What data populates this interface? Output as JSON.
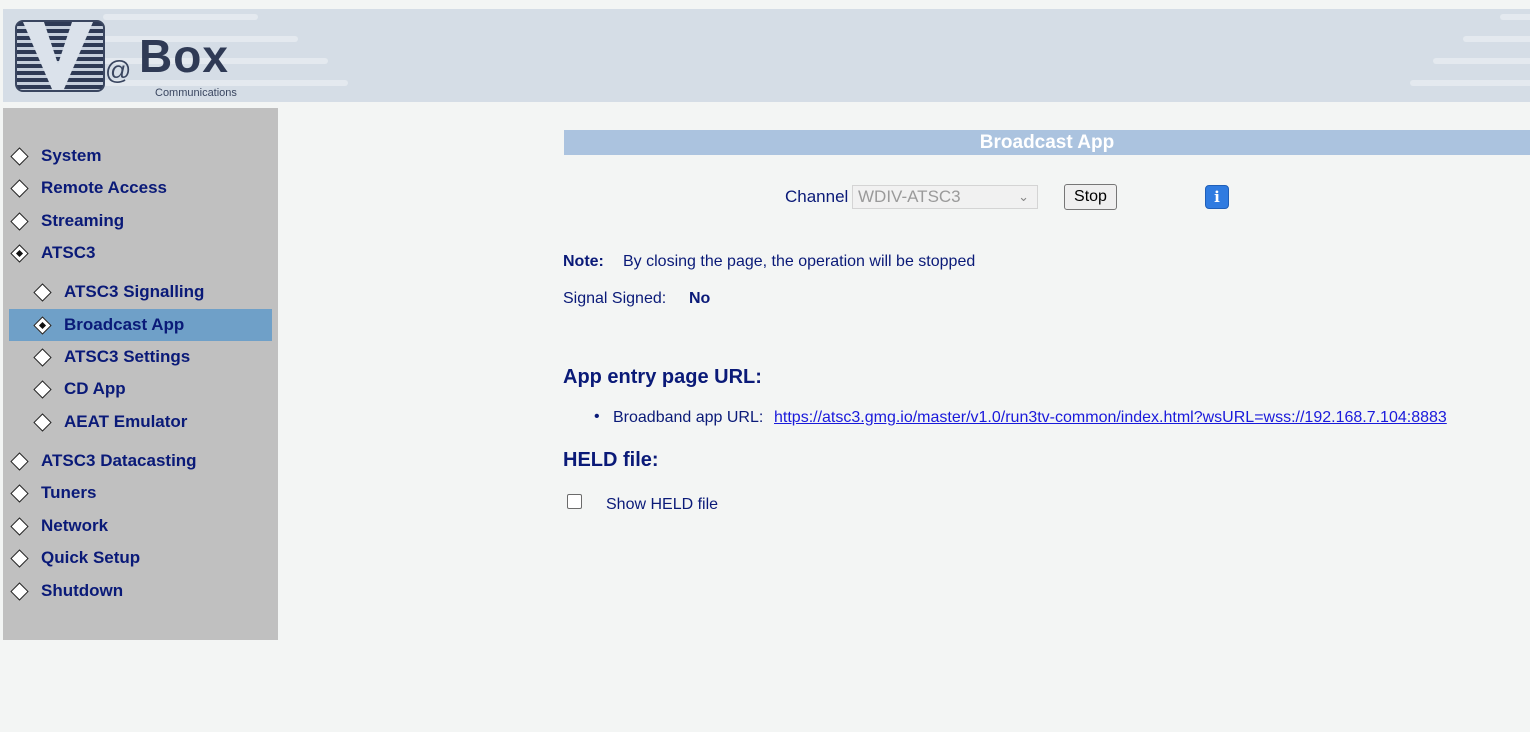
{
  "brand": {
    "logo_at": "@",
    "logo_box": "Box",
    "logo_sub": "Communications"
  },
  "sidebar": {
    "items": [
      {
        "label": "System",
        "active": false,
        "sub": false
      },
      {
        "label": "Remote Access",
        "active": false,
        "sub": false
      },
      {
        "label": "Streaming",
        "active": false,
        "sub": false
      },
      {
        "label": "ATSC3",
        "active": false,
        "sub": false,
        "expanded": true
      },
      {
        "label": "ATSC3 Signalling",
        "active": false,
        "sub": true
      },
      {
        "label": "Broadcast App",
        "active": true,
        "sub": true
      },
      {
        "label": "ATSC3 Settings",
        "active": false,
        "sub": true
      },
      {
        "label": "CD App",
        "active": false,
        "sub": true
      },
      {
        "label": "AEAT Emulator",
        "active": false,
        "sub": true
      },
      {
        "label": "ATSC3 Datacasting",
        "active": false,
        "sub": false
      },
      {
        "label": "Tuners",
        "active": false,
        "sub": false
      },
      {
        "label": "Network",
        "active": false,
        "sub": false
      },
      {
        "label": "Quick Setup",
        "active": false,
        "sub": false
      },
      {
        "label": "Shutdown",
        "active": false,
        "sub": false
      }
    ]
  },
  "main": {
    "title": "Broadcast App",
    "channel_label": "Channel",
    "channel_value": "WDIV-ATSC3",
    "stop_label": "Stop",
    "info_glyph": "i",
    "note_label": "Note:",
    "note_text": "By closing the page, the operation will be stopped",
    "signed_label": "Signal Signed:",
    "signed_value": "No",
    "entry_heading": "App entry page URL:",
    "bullet": "•",
    "url_label": "Broadband app URL:",
    "url_value": "https://atsc3.gmg.io/master/v1.0/run3tv-common/index.html?wsURL=wss://192.168.7.104:8883",
    "held_heading": "HELD file:",
    "held_checkbox_label": "Show HELD file",
    "held_checked": false
  },
  "colors": {
    "nav_text": "#0a1a78",
    "active_bg": "#6fa0c8",
    "sidebar_bg": "#c0c0c0",
    "title_bar": "#abc3df",
    "info_button": "#2f7be0",
    "link": "#1a1adb"
  },
  "icons": {
    "nav_bullet": "diamond-icon",
    "nav_bullet_active": "diamond-filled-icon",
    "info": "info-icon",
    "select": "chevron-down-icon"
  }
}
